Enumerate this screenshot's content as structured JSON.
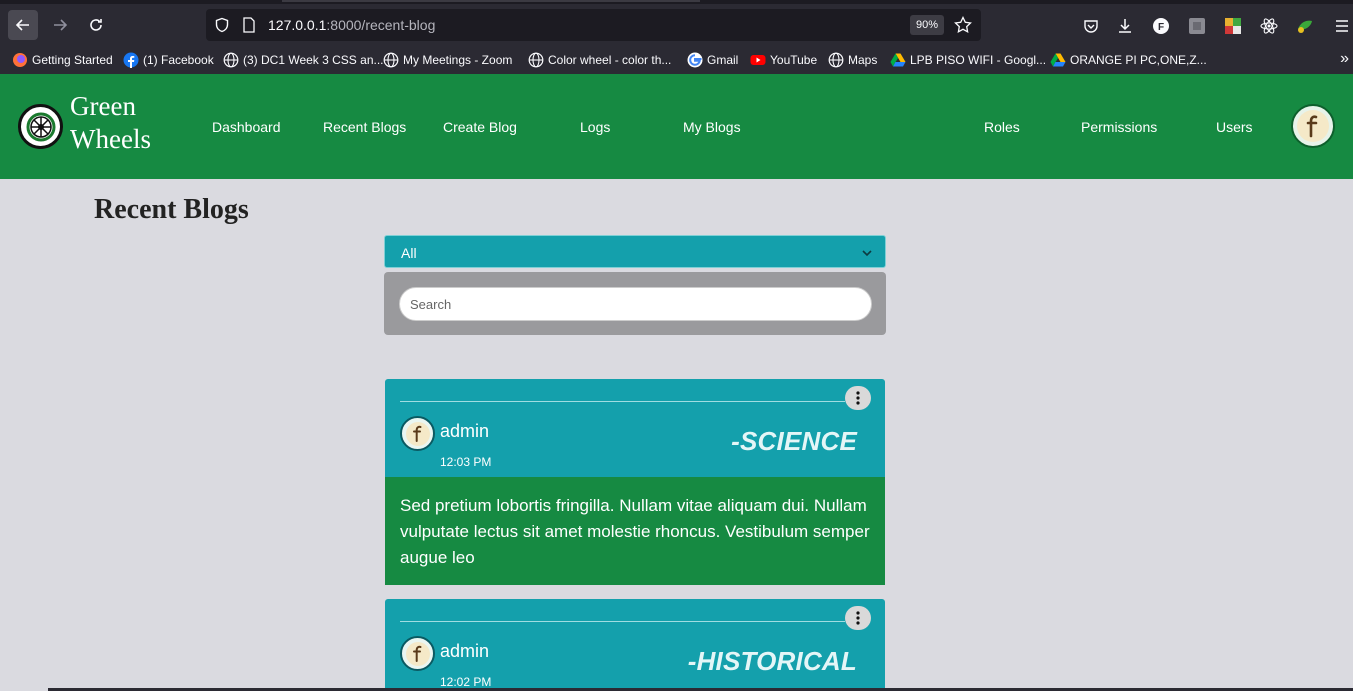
{
  "browser": {
    "url_host": "127.0.0.1",
    "url_path": ":8000/recent-blog",
    "zoom": "90%",
    "bookmarks": [
      {
        "label": "Getting Started",
        "icon": "firefox-icon"
      },
      {
        "label": "(1) Facebook",
        "icon": "facebook-icon"
      },
      {
        "label": "(3) DC1 Week 3 CSS an...",
        "icon": "globe-icon"
      },
      {
        "label": "My Meetings - Zoom",
        "icon": "globe-icon"
      },
      {
        "label": "Color wheel - color th...",
        "icon": "globe-icon"
      },
      {
        "label": "Gmail",
        "icon": "google-icon"
      },
      {
        "label": "YouTube",
        "icon": "youtube-icon"
      },
      {
        "label": "Maps",
        "icon": "globe-icon"
      },
      {
        "label": "LPB PISO WIFI - Googl...",
        "icon": "google-drive-icon"
      },
      {
        "label": "ORANGE PI PC,ONE,Z...",
        "icon": "google-drive-icon"
      }
    ]
  },
  "navbar": {
    "brand_line1": "Green",
    "brand_line2": "Wheels",
    "links": [
      "Dashboard",
      "Recent Blogs",
      "Create Blog",
      "Logs",
      "My Blogs",
      "Roles",
      "Permissions",
      "Users"
    ]
  },
  "page": {
    "title": "Recent Blogs",
    "filter_selected": "All",
    "search_placeholder": "Search"
  },
  "posts": [
    {
      "author": "admin",
      "time": "12:03 PM",
      "category": "-SCIENCE",
      "body": "Sed pretium lobortis fringilla. Nullam vitae aliquam dui. Nullam vulputate lectus sit amet molestie rhoncus. Vestibulum semper augue leo"
    },
    {
      "author": "admin",
      "time": "12:02 PM",
      "category": "-HISTORICAL",
      "body": ""
    }
  ],
  "colors": {
    "navbar_green": "#168a42",
    "card_teal": "#14a0ac",
    "page_bg": "#dadae0"
  }
}
